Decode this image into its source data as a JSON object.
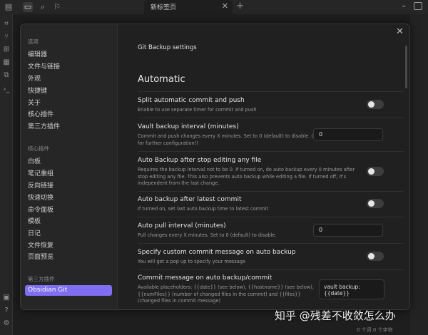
{
  "tab": {
    "title": "新标签页"
  },
  "sidebar": {
    "section_options": "选项",
    "options": [
      "编辑器",
      "文件与链接",
      "外观",
      "快捷键",
      "关于",
      "核心插件",
      "第三方插件"
    ],
    "section_core": "核心插件",
    "core": [
      "白板",
      "笔记重组",
      "反向链接",
      "快速切换",
      "命令面板",
      "模板",
      "日记",
      "文件恢复",
      "页面预览"
    ],
    "section_third": "第三方插件",
    "third": [
      "Obsidian Git"
    ]
  },
  "main": {
    "plugin_title": "Git Backup settings",
    "section_title": "Automatic",
    "settings": [
      {
        "name": "Split automatic commit and push",
        "desc": "Enable to use separate timer for commit and push",
        "control": "toggle"
      },
      {
        "name": "Vault backup interval (minutes)",
        "desc": "Commit and push changes every X minutes. Set to 0 (default) to disable. (See below setting for further configuration!)",
        "control": "input",
        "value": "0"
      },
      {
        "name": "Auto Backup after stop editing any file",
        "desc": "Requires the backup interval not to be 0. If turned on, do auto backup every 0 minutes after stop editing any file. This also prevents auto backup while editing a file. If turned off, it's independent from the last change.",
        "control": "toggle"
      },
      {
        "name": "Auto backup after latest commit",
        "desc": "If turned on, set last auto backup time to latest commit",
        "control": "toggle"
      },
      {
        "name": "Auto pull interval (minutes)",
        "desc": "Pull changes every X minutes. Set to 0 (default) to disable.",
        "control": "input",
        "value": "0"
      },
      {
        "name": "Specify custom commit message on auto backup",
        "desc": "You will get a pop up to specify your message",
        "control": "toggle"
      },
      {
        "name": "Commit message on auto backup/commit",
        "desc": "Available placeholders: {{date}} (see below), {{hostname}} (see below), {{numFiles}} (number of changed files in the commit) and {{files}} (changed files in commit message)",
        "control": "textarea",
        "value": "vault backup: {{date}}"
      }
    ]
  },
  "status_bar": "0 个词  0 个字符",
  "watermark": "知乎 @残差不收敛怎么办",
  "colors": {
    "accent": "#7f6df2",
    "background": "#202020",
    "sidebar": "#262626"
  }
}
